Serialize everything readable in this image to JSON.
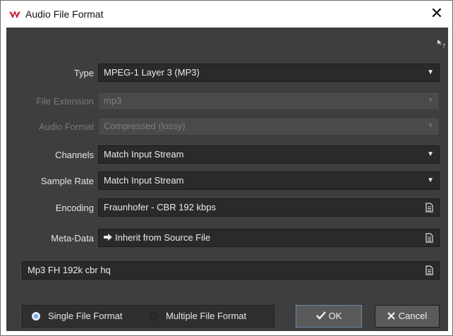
{
  "window": {
    "title": "Audio File Format",
    "close_glyph": "✕"
  },
  "fields": {
    "type": {
      "label": "Type",
      "value": "MPEG-1 Layer 3 (MP3)"
    },
    "file_extension": {
      "label": "File Extension",
      "value": "mp3"
    },
    "audio_format": {
      "label": "Audio Format",
      "value": "Compressed (lossy)"
    },
    "channels": {
      "label": "Channels",
      "value": "Match Input Stream"
    },
    "sample_rate": {
      "label": "Sample Rate",
      "value": "Match Input Stream"
    },
    "encoding": {
      "label": "Encoding",
      "value": "Fraunhofer - CBR 192 kbps"
    },
    "meta_data": {
      "label": "Meta-Data",
      "value": "Inherit from Source File"
    }
  },
  "preset": {
    "value": "Mp3 FH 192k cbr hq"
  },
  "mode": {
    "single": "Single File Format",
    "multiple": "Multiple File Format",
    "selected": "single"
  },
  "buttons": {
    "ok": "OK",
    "cancel": "Cancel"
  },
  "icons": {
    "dropdown_glyph": "▼",
    "app": "wavelab-logo-icon",
    "help": "context-help-icon"
  },
  "colors": {
    "accent": "#6fa8e8",
    "panel": "#3e3e3e",
    "field": "#2a2a2a",
    "logo": "#c8102e"
  }
}
